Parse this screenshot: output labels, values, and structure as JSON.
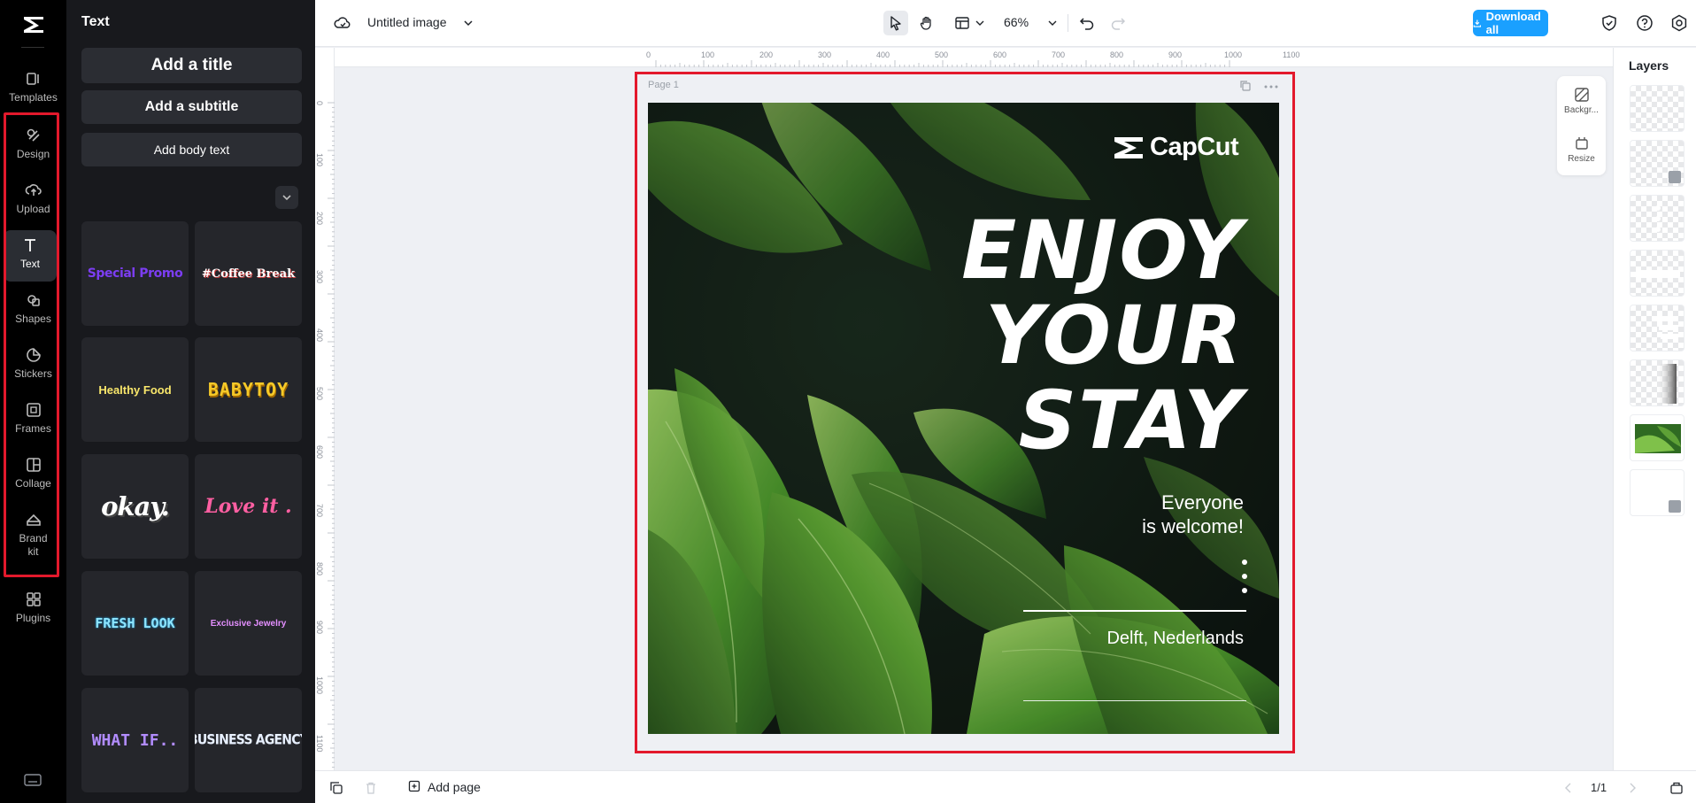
{
  "rail": {
    "items": [
      {
        "label": "Templates",
        "icon": "templates-icon"
      },
      {
        "label": "Design",
        "icon": "design-icon"
      },
      {
        "label": "Upload",
        "icon": "upload-icon"
      },
      {
        "label": "Text",
        "icon": "text-icon",
        "active": true
      },
      {
        "label": "Shapes",
        "icon": "shapes-icon"
      },
      {
        "label": "Stickers",
        "icon": "stickers-icon"
      },
      {
        "label": "Frames",
        "icon": "frames-icon"
      },
      {
        "label": "Collage",
        "icon": "collage-icon"
      },
      {
        "label": "Brand kit",
        "icon": "brand-kit-icon"
      },
      {
        "label": "Plugins",
        "icon": "plugins-icon"
      }
    ]
  },
  "panel": {
    "title": "Text",
    "add_title": "Add a title",
    "add_subtitle": "Add a subtitle",
    "add_body": "Add body text",
    "presets": [
      "Special Promo",
      "#Coffee Break",
      "Healthy Food",
      "BABYTOY",
      "okay.",
      "Love it .",
      "FRESH LOOK",
      "Exclusive Jewelry",
      "WHAT IF..",
      "BUSINESS AGENCY"
    ]
  },
  "topbar": {
    "title": "Untitled image",
    "zoom": "66%",
    "download_label": "Download all"
  },
  "rulers": {
    "h_ticks": [
      "0",
      "100",
      "200",
      "300",
      "400",
      "500",
      "600",
      "700",
      "800",
      "900",
      "1000",
      "1100"
    ],
    "v_ticks": [
      "0",
      "100",
      "200",
      "300",
      "400",
      "500",
      "600",
      "700",
      "800",
      "900",
      "1000",
      "1100"
    ]
  },
  "canvas": {
    "page_label": "Page 1",
    "brand": "CapCut",
    "headline": [
      "ENJOY",
      "YOUR",
      "STAY"
    ],
    "subline": [
      "Everyone",
      "is welcome!"
    ],
    "location": "Delft, Nederlands"
  },
  "tools": {
    "background_label": "Backgr...",
    "resize_label": "Resize"
  },
  "layers": {
    "title": "Layers"
  },
  "bottombar": {
    "add_page": "Add page",
    "page_count": "1/1"
  },
  "colors": {
    "accent": "#1aa0ff",
    "highlight": "#e3192c",
    "rail_bg": "#000000",
    "panel_bg": "#18191d"
  }
}
